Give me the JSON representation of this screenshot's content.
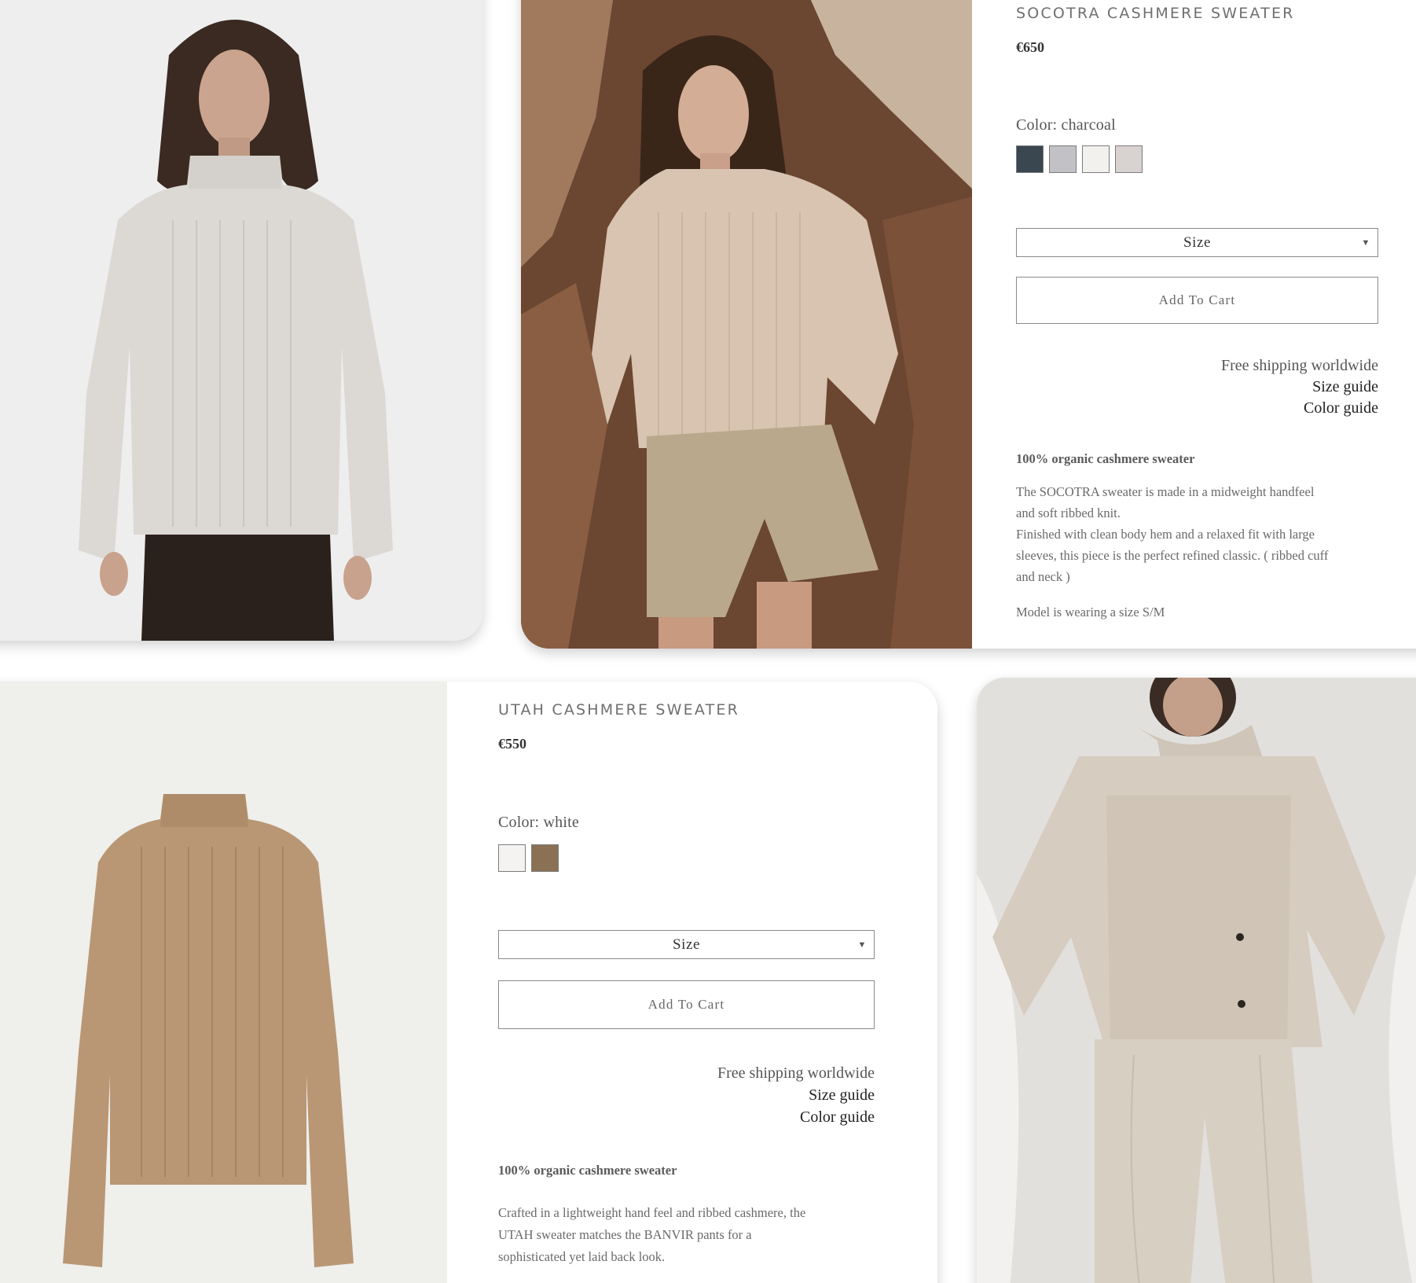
{
  "products": [
    {
      "title": "SOCOTRA CASHMERE SWEATER",
      "price": "€650",
      "color_label": "Color: charcoal",
      "swatches": [
        "#3a4650",
        "#c2c1c5",
        "#f3f1ee",
        "#d8d2d0"
      ],
      "size_label": "Size",
      "add_to_cart": "Add To Cart",
      "shipping": "Free shipping worldwide",
      "size_guide": "Size guide",
      "color_guide": "Color guide",
      "desc_heading": "100% organic cashmere sweater",
      "desc_lines": [
        "The SOCOTRA sweater is made in a midweight handfeel",
        "and soft ribbed knit.",
        "Finished with clean body hem and a relaxed fit with large",
        "sleeves, this piece is the perfect refined classic. ( ribbed cuff",
        "and neck )"
      ],
      "model_note": "Model is wearing a size S/M"
    },
    {
      "title": "UTAH CASHMERE SWEATER",
      "price": "€550",
      "color_label": "Color: white",
      "swatches": [
        "#f5f3f2",
        "#8b7153"
      ],
      "size_label": "Size",
      "add_to_cart": "Add To Cart",
      "shipping": "Free shipping worldwide",
      "size_guide": "Size guide",
      "color_guide": "Color guide",
      "desc_heading": "100% organic cashmere sweater",
      "desc_lines": [
        "Crafted in a lightweight hand feel and ribbed cashmere, the",
        "UTAH sweater matches the BANVIR pants for a",
        "sophisticated yet laid back look."
      ]
    }
  ],
  "colors": {
    "background": "#ffffff",
    "studio_wall": "#ececec",
    "rock_brown": "#6e4a33",
    "camel": "#b8966e",
    "oatmeal": "#d6cdc2"
  },
  "photos": [
    "model-white-turtleneck-photo",
    "model-rock-beige-sweater-photo",
    "camel-sweater-product-photo",
    "model-knit-set-bed-photo"
  ]
}
